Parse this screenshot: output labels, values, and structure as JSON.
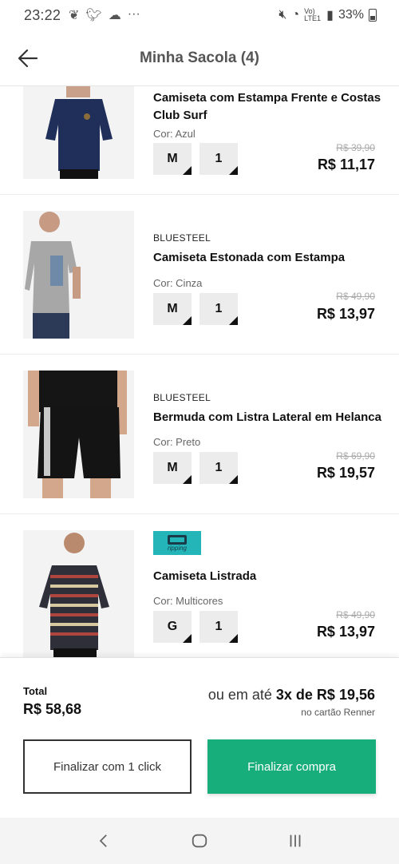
{
  "status_bar": {
    "time": "23:22",
    "dots": "···",
    "network": "Vo) LTE1",
    "battery": "33%"
  },
  "header": {
    "title": "Minha Sacola (4)"
  },
  "items": [
    {
      "brand": "",
      "name": "Camiseta com Estampa Frente e Costas Club Surf",
      "color": "Cor: Azul",
      "size": "M",
      "qty": "1",
      "old_price": "R$ 39,90",
      "price": "R$ 11,17"
    },
    {
      "brand": "BLUESTEEL",
      "name": "Camiseta Estonada com Estampa",
      "color": "Cor: Cinza",
      "size": "M",
      "qty": "1",
      "old_price": "R$ 49,90",
      "price": "R$ 13,97"
    },
    {
      "brand": "BLUESTEEL",
      "name": "Bermuda com Listra Lateral em Helanca",
      "color": "Cor: Preto",
      "size": "M",
      "qty": "1",
      "old_price": "R$ 69,90",
      "price": "R$ 19,57"
    },
    {
      "brand": "ripping",
      "name": "Camiseta Listrada",
      "color": "Cor: Multicores",
      "size": "G",
      "qty": "1",
      "old_price": "R$ 49,90",
      "price": "R$ 13,97"
    }
  ],
  "summary": {
    "total_label": "Total",
    "total_value": "R$ 58,68",
    "installment_prefix": "ou em até",
    "installment_value": "3x de R$ 19,56",
    "installment_note": "no cartão Renner"
  },
  "buttons": {
    "one_click": "Finalizar com 1 click",
    "checkout": "Finalizar compra"
  },
  "colors": {
    "accent_green": "#18ae7b",
    "ripping_teal": "#23b5b8"
  }
}
